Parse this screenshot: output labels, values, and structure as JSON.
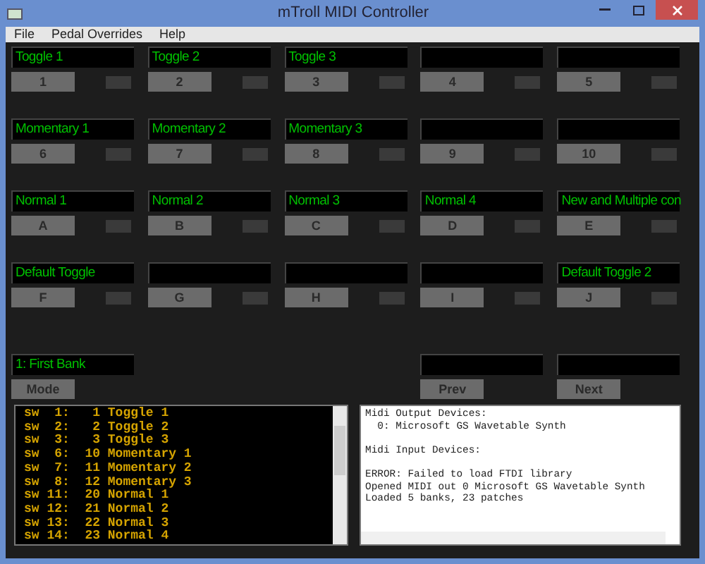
{
  "window": {
    "title": "mTroll MIDI Controller"
  },
  "menu": [
    "File",
    "Pedal Overrides",
    "Help"
  ],
  "switch_rows": [
    [
      {
        "label": "Toggle 1",
        "button": "1"
      },
      {
        "label": "Toggle 2",
        "button": "2"
      },
      {
        "label": "Toggle 3",
        "button": "3"
      },
      {
        "button": "4"
      },
      {
        "button": "5"
      }
    ],
    [
      {
        "label": "Momentary 1",
        "button": "6"
      },
      {
        "label": "Momentary 2",
        "button": "7"
      },
      {
        "label": "Momentary 3",
        "button": "8"
      },
      {
        "button": "9"
      },
      {
        "button": "10"
      }
    ],
    [
      {
        "label": "Normal 1",
        "button": "A"
      },
      {
        "label": "Normal 2",
        "button": "B"
      },
      {
        "label": "Normal 3",
        "button": "C"
      },
      {
        "label": "Normal 4",
        "button": "D"
      },
      {
        "label": "New and Multiple con",
        "button": "E"
      }
    ],
    [
      {
        "label": "Default Toggle",
        "button": "F"
      },
      {
        "button": "G"
      },
      {
        "button": "H"
      },
      {
        "button": "I"
      },
      {
        "label": "Default Toggle 2",
        "button": "J"
      }
    ]
  ],
  "bank_row": [
    {
      "kind": "control",
      "label": "1: First Bank",
      "button": "Mode"
    },
    {
      "kind": "empty"
    },
    {
      "kind": "empty"
    },
    {
      "kind": "control",
      "button": "Prev"
    },
    {
      "kind": "control",
      "button": "Next"
    }
  ],
  "switch_list": [
    "sw  1:   1 Toggle 1",
    "sw  2:   2 Toggle 2",
    "sw  3:   3 Toggle 3",
    "sw  6:  10 Momentary 1",
    "sw  7:  11 Momentary 2",
    "sw  8:  12 Momentary 3",
    "sw 11:  20 Normal 1",
    "sw 12:  21 Normal 2",
    "sw 13:  22 Normal 3",
    "sw 14:  23 Normal 4"
  ],
  "log_blocks": [
    [
      "Midi Output Devices:",
      "  0: Microsoft GS Wavetable Synth"
    ],
    [
      "Midi Input Devices:"
    ],
    [
      "ERROR: Failed to load FTDI library",
      "Opened MIDI out 0 Microsoft GS Wavetable Synth",
      "Loaded 5 banks, 23 patches"
    ]
  ]
}
